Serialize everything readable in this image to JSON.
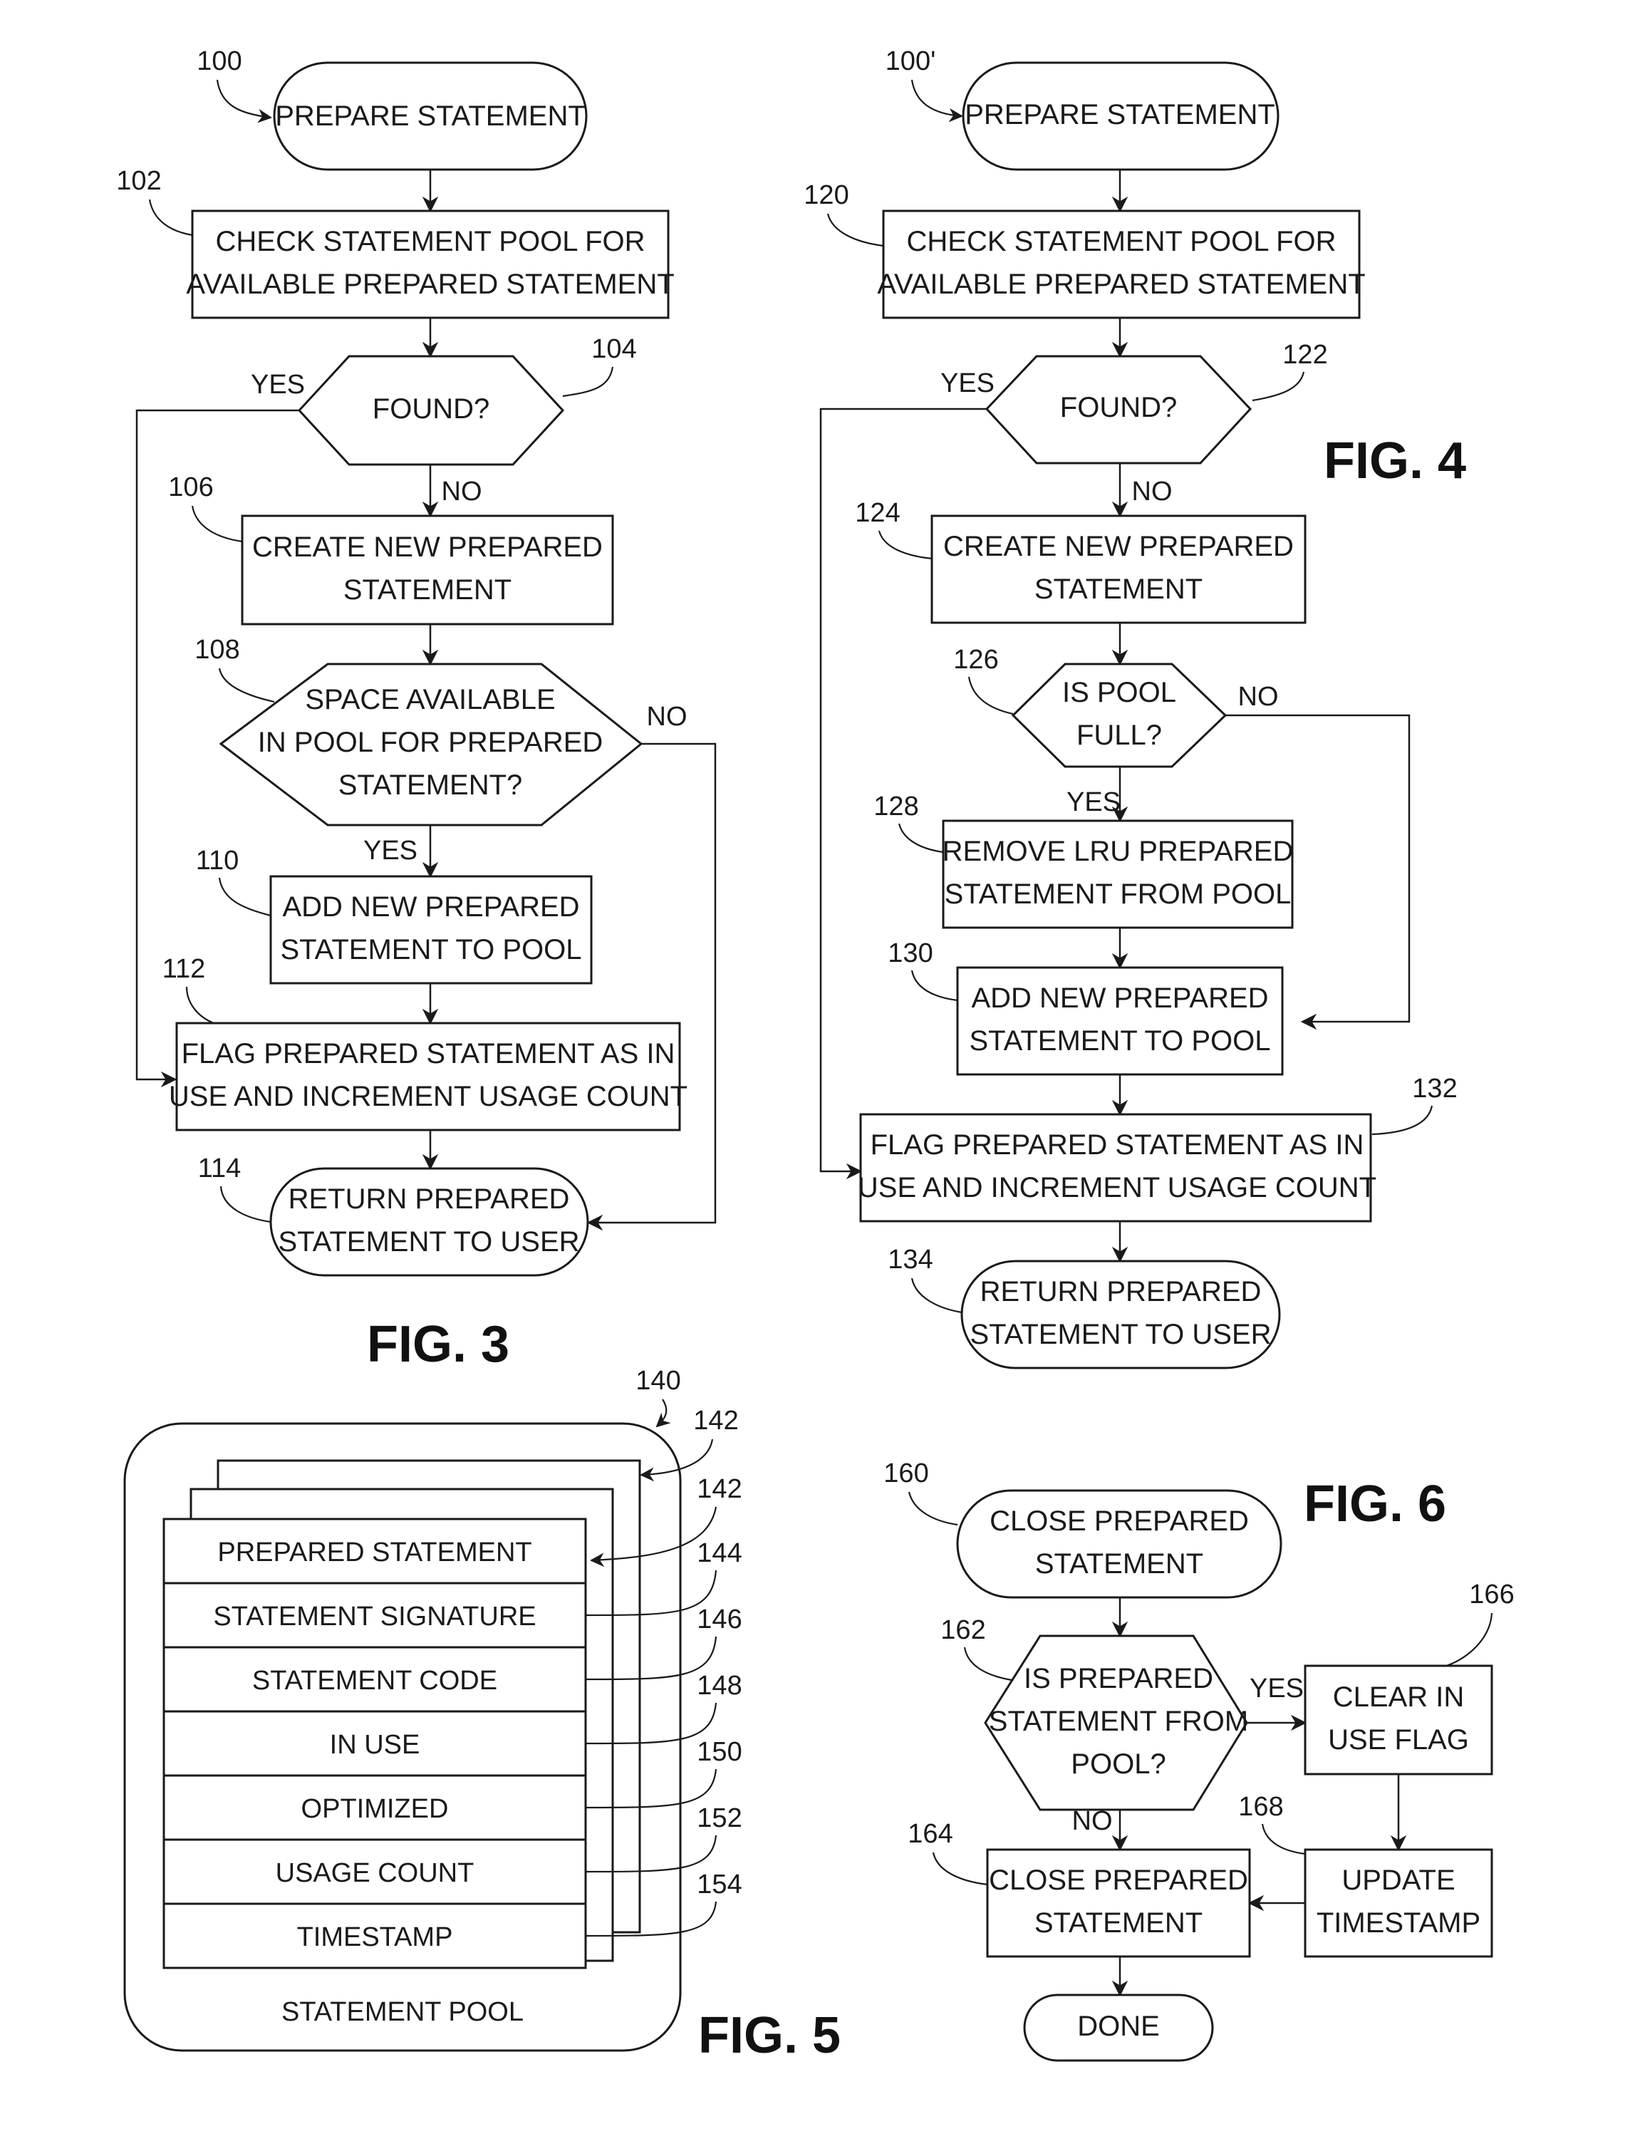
{
  "figures": {
    "fig3": {
      "title": "FIG. 3",
      "nodes": {
        "start": {
          "ref": "100",
          "text": [
            "PREPARE STATEMENT"
          ]
        },
        "check": {
          "ref": "102",
          "text": [
            "CHECK STATEMENT POOL FOR",
            "AVAILABLE PREPARED STATEMENT"
          ]
        },
        "found": {
          "ref": "104",
          "text": [
            "FOUND?"
          ]
        },
        "create": {
          "ref": "106",
          "text": [
            "CREATE NEW PREPARED",
            "STATEMENT"
          ]
        },
        "space": {
          "ref": "108",
          "text": [
            "SPACE AVAILABLE",
            "IN POOL FOR PREPARED",
            "STATEMENT?"
          ]
        },
        "add": {
          "ref": "110",
          "text": [
            "ADD NEW PREPARED",
            "STATEMENT TO POOL"
          ]
        },
        "flag": {
          "ref": "112",
          "text": [
            "FLAG PREPARED STATEMENT AS IN",
            "USE AND INCREMENT USAGE COUNT"
          ]
        },
        "return": {
          "ref": "114",
          "text": [
            "RETURN PREPARED",
            "STATEMENT TO USER"
          ]
        }
      },
      "edge_labels": {
        "found_yes": "YES",
        "found_no": "NO",
        "space_yes": "YES",
        "space_no": "NO"
      }
    },
    "fig4": {
      "title": "FIG. 4",
      "nodes": {
        "start": {
          "ref": "100'",
          "text": [
            "PREPARE STATEMENT"
          ]
        },
        "check": {
          "ref": "120",
          "text": [
            "CHECK STATEMENT POOL FOR",
            "AVAILABLE PREPARED STATEMENT"
          ]
        },
        "found": {
          "ref": "122",
          "text": [
            "FOUND?"
          ]
        },
        "create": {
          "ref": "124",
          "text": [
            "CREATE NEW PREPARED",
            "STATEMENT"
          ]
        },
        "full": {
          "ref": "126",
          "text": [
            "IS POOL",
            "FULL?"
          ]
        },
        "remove": {
          "ref": "128",
          "text": [
            "REMOVE LRU PREPARED",
            "STATEMENT FROM POOL"
          ]
        },
        "add": {
          "ref": "130",
          "text": [
            "ADD NEW PREPARED",
            "STATEMENT TO POOL"
          ]
        },
        "flag": {
          "ref": "132",
          "text": [
            "FLAG PREPARED STATEMENT AS IN",
            "USE AND INCREMENT USAGE COUNT"
          ]
        },
        "return": {
          "ref": "134",
          "text": [
            "RETURN PREPARED",
            "STATEMENT TO USER"
          ]
        }
      },
      "edge_labels": {
        "found_yes": "YES",
        "found_no": "NO",
        "full_yes": "YES",
        "full_no": "NO"
      }
    },
    "fig5": {
      "title": "FIG. 5",
      "pool_label": "STATEMENT POOL",
      "pool_ref": "140",
      "stack_refs": [
        "142",
        "142"
      ],
      "fields": [
        {
          "label": "PREPARED STATEMENT",
          "ref": "144"
        },
        {
          "label": "STATEMENT SIGNATURE",
          "ref": "146"
        },
        {
          "label": "STATEMENT CODE",
          "ref": "148"
        },
        {
          "label": "IN USE",
          "ref": "150"
        },
        {
          "label": "OPTIMIZED",
          "ref": "152"
        },
        {
          "label": "USAGE COUNT",
          "ref": "154"
        },
        {
          "label": "TIMESTAMP",
          "ref": ""
        }
      ]
    },
    "fig6": {
      "title": "FIG. 6",
      "nodes": {
        "start": {
          "ref": "160",
          "text": [
            "CLOSE PREPARED",
            "STATEMENT"
          ]
        },
        "frompool": {
          "ref": "162",
          "text": [
            "IS PREPARED",
            "STATEMENT FROM",
            "POOL?"
          ]
        },
        "close": {
          "ref": "164",
          "text": [
            "CLOSE PREPARED",
            "STATEMENT"
          ]
        },
        "clear": {
          "ref": "166",
          "text": [
            "CLEAR IN",
            "USE FLAG"
          ]
        },
        "update": {
          "ref": "168",
          "text": [
            "UPDATE",
            "TIMESTAMP"
          ]
        },
        "done": {
          "ref": "",
          "text": [
            "DONE"
          ]
        }
      },
      "edge_labels": {
        "yes": "YES",
        "no": "NO"
      }
    }
  }
}
